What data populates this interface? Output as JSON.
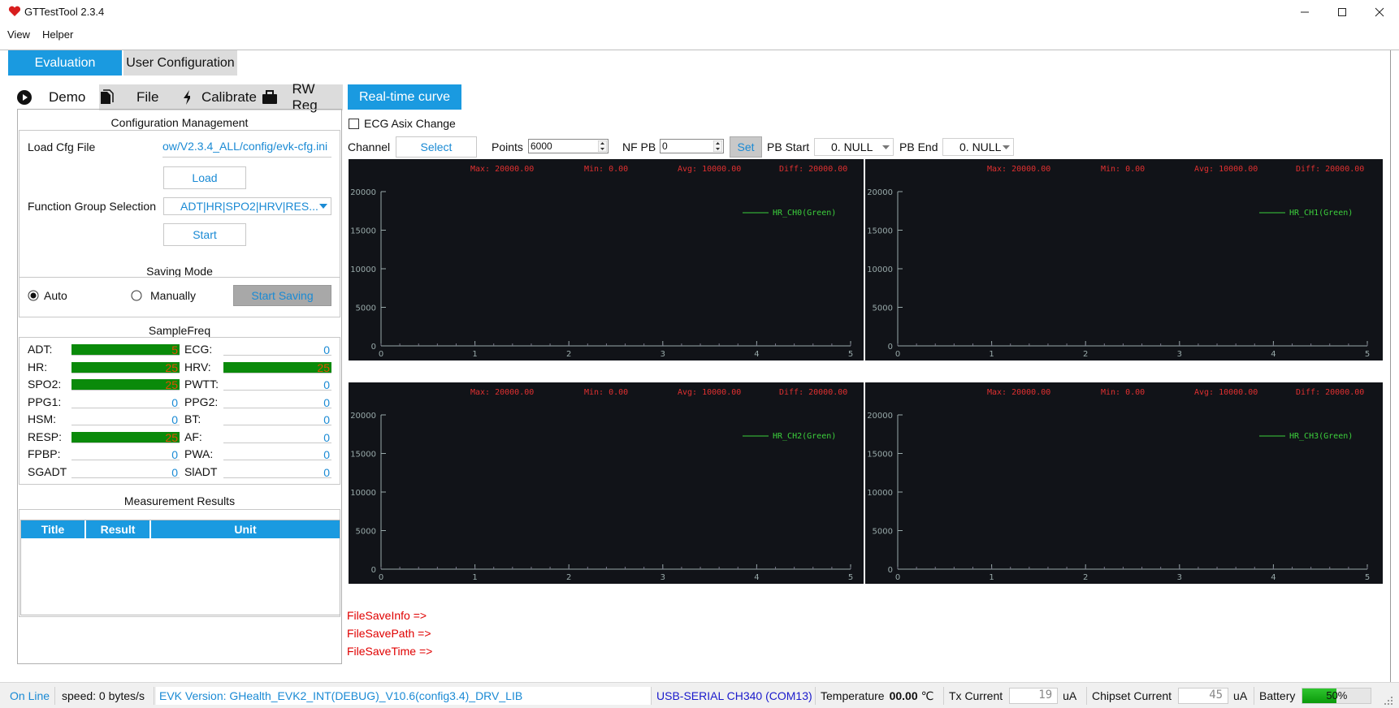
{
  "window": {
    "title": "GTTestTool 2.3.4"
  },
  "menu": {
    "view": "View",
    "helper": "Helper"
  },
  "main_tabs": {
    "evaluation": "Evaluation",
    "user_config": "User Configuration"
  },
  "sub_tabs": {
    "demo": "Demo",
    "file": "File",
    "calibrate": "Calibrate",
    "rw_reg": "RW Reg"
  },
  "config": {
    "title": "Configuration Management",
    "load_cfg_label": "Load Cfg File",
    "cfg_path": "ow/V2.3.4_ALL/config/evk-cfg.ini",
    "load_btn": "Load",
    "func_group_label": "Function Group Selection",
    "func_group_value": "ADT|HR|SPO2|HRV|RES...",
    "start_btn": "Start"
  },
  "saving": {
    "title": "Saving Mode",
    "auto": "Auto",
    "manually": "Manually",
    "start_saving": "Start Saving",
    "selected": "auto"
  },
  "sample_freq": {
    "title": "SampleFreq",
    "left": [
      {
        "label": "ADT:",
        "value": "5",
        "bar": 1.0
      },
      {
        "label": "HR:",
        "value": "25",
        "bar": 1.0
      },
      {
        "label": "SPO2:",
        "value": "25",
        "bar": 1.0
      },
      {
        "label": "PPG1:",
        "value": "0",
        "bar": 0
      },
      {
        "label": "HSM:",
        "value": "0",
        "bar": 0
      },
      {
        "label": "RESP:",
        "value": "25",
        "bar": 1.0
      },
      {
        "label": "FPBP:",
        "value": "0",
        "bar": 0
      },
      {
        "label": "SGADT",
        "value": "0",
        "bar": 0
      }
    ],
    "right": [
      {
        "label": "ECG:",
        "value": "0",
        "bar": 0
      },
      {
        "label": "HRV:",
        "value": "25",
        "bar": 1.0
      },
      {
        "label": "PWTT:",
        "value": "0",
        "bar": 0
      },
      {
        "label": "PPG2:",
        "value": "0",
        "bar": 0
      },
      {
        "label": "BT:",
        "value": "0",
        "bar": 0
      },
      {
        "label": "AF:",
        "value": "0",
        "bar": 0
      },
      {
        "label": "PWA:",
        "value": "0",
        "bar": 0
      },
      {
        "label": "SlADT",
        "value": "0",
        "bar": 0
      }
    ]
  },
  "measurement": {
    "title": "Measurement Results",
    "columns": [
      "Title",
      "Result",
      "Unit"
    ]
  },
  "realtime": {
    "tab": "Real-time curve",
    "ecg_axis_change": "ECG Asix Change",
    "channel_label": "Channel",
    "select_btn": "Select",
    "points_label": "Points",
    "points_value": "6000",
    "nfpb_label": "NF PB",
    "nfpb_value": "0",
    "set_btn": "Set",
    "pb_start_label": "PB Start",
    "pb_start_value": "0. NULL",
    "pb_end_label": "PB End",
    "pb_end_value": "0. NULL"
  },
  "chart_data": [
    {
      "type": "line",
      "series": [
        {
          "name": "HR_CH0(Green)",
          "x": [],
          "y": []
        }
      ],
      "stats": {
        "max": "Max: 20000.00",
        "min": "Min: 0.00",
        "avg": "Avg: 10000.00",
        "diff": "Diff: 20000.00"
      },
      "xlim": [
        0,
        5
      ],
      "ylim": [
        0,
        20000
      ],
      "xticks": [
        "0",
        "1",
        "2",
        "3",
        "4",
        "5"
      ],
      "yticks": [
        "0",
        "5000",
        "10000",
        "15000",
        "20000"
      ]
    },
    {
      "type": "line",
      "series": [
        {
          "name": "HR_CH1(Green)",
          "x": [],
          "y": []
        }
      ],
      "stats": {
        "max": "Max: 20000.00",
        "min": "Min: 0.00",
        "avg": "Avg: 10000.00",
        "diff": "Diff: 20000.00"
      },
      "xlim": [
        0,
        5
      ],
      "ylim": [
        0,
        20000
      ],
      "xticks": [
        "0",
        "1",
        "2",
        "3",
        "4",
        "5"
      ],
      "yticks": [
        "0",
        "5000",
        "10000",
        "15000",
        "20000"
      ]
    },
    {
      "type": "line",
      "series": [
        {
          "name": "HR_CH2(Green)",
          "x": [],
          "y": []
        }
      ],
      "stats": {
        "max": "Max: 20000.00",
        "min": "Min: 0.00",
        "avg": "Avg: 10000.00",
        "diff": "Diff: 20000.00"
      },
      "xlim": [
        0,
        5
      ],
      "ylim": [
        0,
        20000
      ],
      "xticks": [
        "0",
        "1",
        "2",
        "3",
        "4",
        "5"
      ],
      "yticks": [
        "0",
        "5000",
        "10000",
        "15000",
        "20000"
      ]
    },
    {
      "type": "line",
      "series": [
        {
          "name": "HR_CH3(Green)",
          "x": [],
          "y": []
        }
      ],
      "stats": {
        "max": "Max: 20000.00",
        "min": "Min: 0.00",
        "avg": "Avg: 10000.00",
        "diff": "Diff: 20000.00"
      },
      "xlim": [
        0,
        5
      ],
      "ylim": [
        0,
        20000
      ],
      "xticks": [
        "0",
        "1",
        "2",
        "3",
        "4",
        "5"
      ],
      "yticks": [
        "0",
        "5000",
        "10000",
        "15000",
        "20000"
      ]
    }
  ],
  "file_save": {
    "info": "FileSaveInfo =>",
    "path": "FileSavePath =>",
    "time": "FileSaveTime =>"
  },
  "status": {
    "online": "On Line",
    "speed": "speed: 0 bytes/s",
    "evk_version": "EVK Version: GHealth_EVK2_INT(DEBUG)_V10.6(config3.4)_DRV_LIB",
    "port": "USB-SERIAL CH340 (COM13)",
    "temperature_label": "Temperature",
    "temperature_value": "00.00",
    "temperature_unit": "℃",
    "tx_label": "Tx Current",
    "tx_value": "19",
    "tx_unit": "uA",
    "chipset_label": "Chipset Current",
    "chipset_value": "45",
    "chipset_unit": "uA",
    "battery_label": "Battery",
    "battery_value": "50%",
    "battery_level": 0.5
  },
  "colors": {
    "accent": "#1a9ae0",
    "bar_green": "#0a8a0a",
    "chart_bg": "#111318",
    "stat_red": "#e03030",
    "curve_green": "#3ccf3c"
  }
}
